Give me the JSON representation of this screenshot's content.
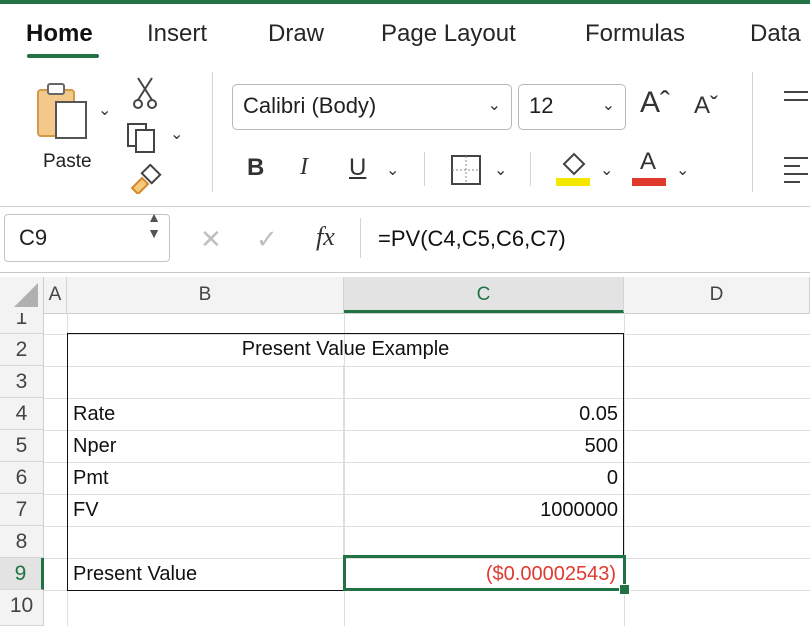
{
  "tabs": [
    "Home",
    "Insert",
    "Draw",
    "Page Layout",
    "Formulas",
    "Data"
  ],
  "ribbon": {
    "paste_label": "Paste",
    "font_name": "Calibri (Body)",
    "font_size": "12",
    "grow_font": "Aˆ",
    "shrink_font": "Aˇ",
    "bold": "B",
    "italic": "I",
    "underline": "U",
    "font_color_letter": "A",
    "highlight_color": "#f5e800",
    "font_color": "#e03a2f"
  },
  "formula_bar": {
    "cell_ref": "C9",
    "cancel_icon": "✕",
    "confirm_icon": "✓",
    "fx": "fx",
    "formula": "=PV(C4,C5,C6,C7)"
  },
  "columns": [
    "A",
    "B",
    "C",
    "D"
  ],
  "rows": [
    "1",
    "2",
    "3",
    "4",
    "5",
    "6",
    "7",
    "8",
    "9",
    "10"
  ],
  "sheet": {
    "title": "Present Value Example",
    "labels": [
      "Rate",
      "Nper",
      "Pmt",
      "FV"
    ],
    "values": [
      "0.05",
      "500",
      "0",
      "1000000"
    ],
    "result_label": "Present Value",
    "result_value": "($0.00002543)",
    "result_color": "#e03a2f"
  },
  "accent": "#217346"
}
